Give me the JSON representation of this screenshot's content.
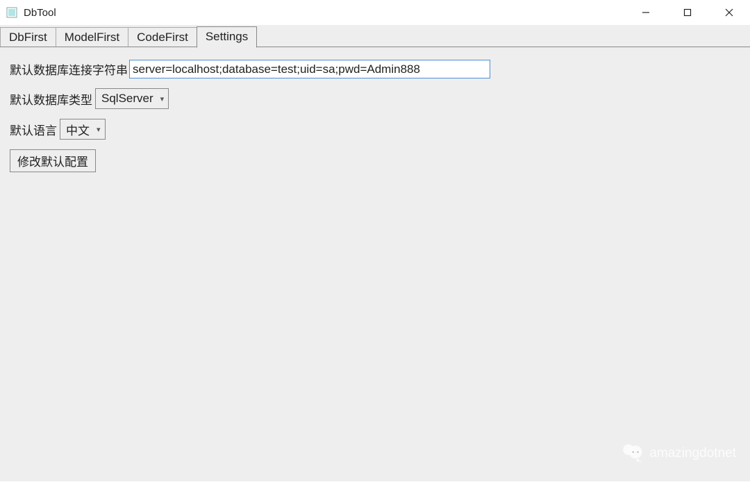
{
  "window": {
    "title": "DbTool"
  },
  "tabs": [
    {
      "label": "DbFirst"
    },
    {
      "label": "ModelFirst"
    },
    {
      "label": "CodeFirst"
    },
    {
      "label": "Settings"
    }
  ],
  "settings": {
    "connStringLabel": "默认数据库连接字符串",
    "connStringValue": "server=localhost;database=test;uid=sa;pwd=Admin888",
    "dbTypeLabel": "默认数据库类型",
    "dbTypeValue": "SqlServer",
    "langLabel": "默认语言",
    "langValue": "中文",
    "saveButton": "修改默认配置"
  },
  "watermark": {
    "text": "amazingdotnet"
  }
}
